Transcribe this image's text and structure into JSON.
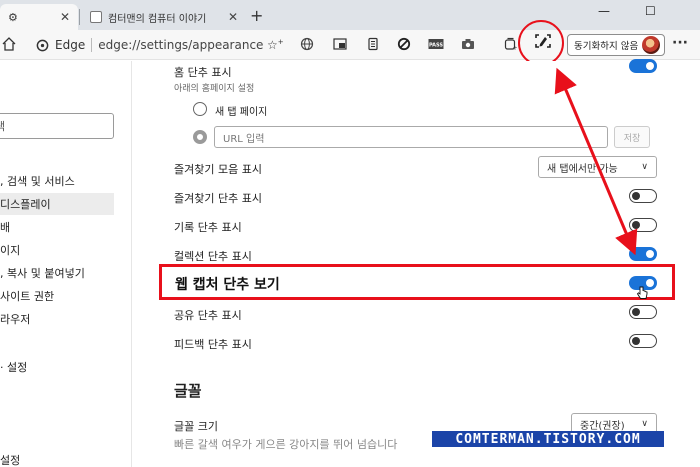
{
  "tabs": [
    {
      "label": "",
      "close": "✕"
    },
    {
      "label": "컴터맨의 컴퓨터 이야기",
      "close": "✕"
    }
  ],
  "new_tab": "+",
  "window_controls": {
    "minimize": "—",
    "maximize": "☐"
  },
  "address_bar": {
    "brand": "Edge",
    "url": "edge://settings/appearance"
  },
  "profile": {
    "sync_label": "동기화하지 않음"
  },
  "more_label": "···",
  "sidebar": {
    "search_text": "색",
    "items": [
      {
        "label": ", 검색 및 서비스",
        "active": false
      },
      {
        "label": " 디스플레이",
        "active": true
      },
      {
        "label": "배",
        "active": false
      },
      {
        "label": "이지",
        "active": false
      },
      {
        "label": ", 복사 및 붙여넣기",
        "active": false
      },
      {
        "label": "사이트 권한",
        "active": false
      },
      {
        "label": "라우저",
        "active": false
      },
      {
        "label": "",
        "active": false
      },
      {
        "label": "· 설정",
        "active": false
      },
      {
        "label": "설정",
        "active": false
      }
    ]
  },
  "settings": {
    "home_button": {
      "label": "홈 단추 표시",
      "sublabel": "아래의 홈페이지 설정",
      "on": true
    },
    "radio_new_tab": "새 탭 페이지",
    "url_placeholder": "URL 입력",
    "save_label": "저장",
    "favorites_bar": {
      "label": "즐겨찾기 모음 표시",
      "value": "새 탭에서만 가능"
    },
    "favorites_button": {
      "label": "즐겨찾기 단추 표시",
      "on": false
    },
    "history_button": {
      "label": "기록 단추 표시",
      "on": false
    },
    "collections_button": {
      "label": "컬렉션 단추 표시",
      "on": true
    },
    "web_capture_button": {
      "label": "웹 캡처 단추 보기",
      "on": true
    },
    "share_button": {
      "label": "공유 단추 표시",
      "on": false
    },
    "feedback_button": {
      "label": "피드백 단추 표시",
      "on": false
    },
    "fonts_section": "글꼴",
    "font_size": {
      "label": "글꼴 크기",
      "value": "중간(권장)"
    },
    "font_preview": "빠른 갈색 여우가 게으른 강아지를 뛰어 넘습니다"
  },
  "watermark": "COMTERMAN.TISTORY.COM",
  "colors": {
    "accent": "#1a73d8",
    "highlight": "#e8101b",
    "watermark_bg": "#1b44a8"
  }
}
